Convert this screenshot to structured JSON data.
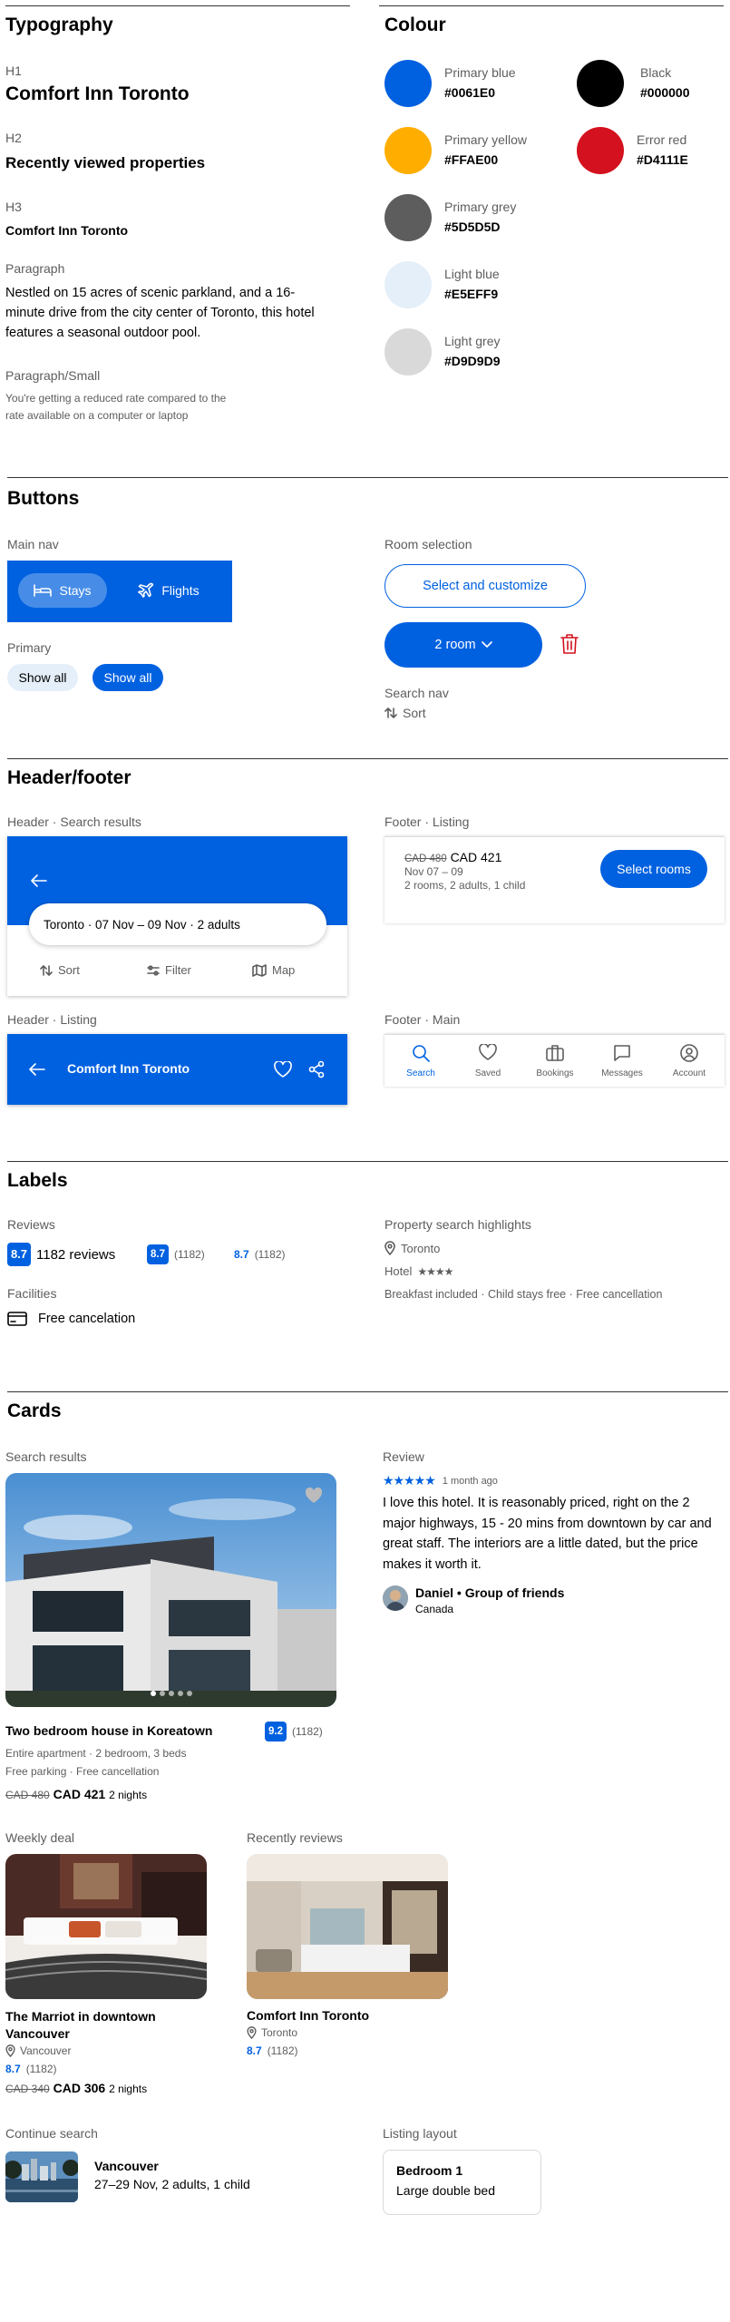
{
  "typography": {
    "title": "Typography",
    "h1_label": "H1",
    "h1_sample": "Comfort Inn Toronto",
    "h2_label": "H2",
    "h2_sample": "Recently viewed properties",
    "h3_label": "H3",
    "h3_sample": "Comfort Inn Toronto",
    "para_label": "Paragraph",
    "para_sample": "Nestled on 15 acres of scenic parkland, and a 16-minute drive from the city center of Toronto, this hotel features a seasonal outdoor pool.",
    "small_label": "Paragraph/Small",
    "small_sample": "You're getting a reduced rate compared to the rate available on a computer or laptop"
  },
  "colour": {
    "title": "Colour",
    "swatches": [
      {
        "name": "Primary blue",
        "hex": "#0061E0"
      },
      {
        "name": "Black",
        "hex": "#000000"
      },
      {
        "name": "Primary yellow",
        "hex": "#FFAE00"
      },
      {
        "name": "Error red",
        "hex": "#D4111E"
      },
      {
        "name": "Primary grey",
        "hex": "#5D5D5D"
      },
      {
        "name": "Light blue",
        "hex": "#E5EFF9"
      },
      {
        "name": "Light grey",
        "hex": "#D9D9D9"
      }
    ]
  },
  "buttons": {
    "title": "Buttons",
    "main_nav_label": "Main nav",
    "stays": "Stays",
    "flights": "Flights",
    "primary_label": "Primary",
    "show_all": "Show all",
    "room_selection_label": "Room selection",
    "select_customize": "Select and customize",
    "room_count": "2 room",
    "search_nav_label": "Search nav",
    "sort": "Sort"
  },
  "header_footer": {
    "title": "Header/footer",
    "search_results_label": "Header · Search results",
    "search_summary": "Toronto · 07 Nov – 09 Nov · 2 adults",
    "sort": "Sort",
    "filter": "Filter",
    "map": "Map",
    "listing_label": "Header · Listing",
    "listing_title": "Comfort Inn Toronto",
    "footer_listing_label": "Footer · Listing",
    "old_price": "CAD 480",
    "new_price": "CAD 421",
    "dates": "Nov 07 – 09",
    "guests": "2 rooms, 2 adults, 1 child",
    "select_rooms": "Select rooms",
    "footer_main_label": "Footer · Main",
    "tabs": [
      "Search",
      "Saved",
      "Bookings",
      "Messages",
      "Account"
    ]
  },
  "labels": {
    "title": "Labels",
    "reviews_label": "Reviews",
    "score": "8.7",
    "reviews_text": "1182 reviews",
    "reviews_count": "(1182)",
    "facilities_label": "Facilities",
    "free_cancel": "Free cancelation",
    "highlights_label": "Property search highlights",
    "location": "Toronto",
    "property_type": "Hotel",
    "amenities": "Breakfast included · Child stays free · Free cancellation"
  },
  "cards": {
    "title": "Cards",
    "search_results_label": "Search results",
    "house_title": "Two bedroom house in Koreatown",
    "house_score": "9.2",
    "house_count": "(1182)",
    "house_desc": "Entire apartment · 2 bedroom, 3 beds",
    "house_extras": "Free parking · Free cancellation",
    "house_old_price": "CAD 480",
    "house_new_price": "CAD 421",
    "house_nights": "2 nights",
    "review_label": "Review",
    "review_time": "1 month ago",
    "review_text": "I love this hotel. It is reasonably priced, right on the 2 major highways, 15 - 20 mins from downtown by car and great staff. The interiors are a little dated, but the price makes it worth it.",
    "reviewer": "Daniel • Group of friends",
    "reviewer_country": "Canada",
    "weekly_label": "Weekly deal",
    "marriot_title": "The Marriot in downtown Vancouver",
    "marriot_location": "Vancouver",
    "marriot_score": "8.7",
    "marriot_count": "(1182)",
    "marriot_old_price": "CAD 340",
    "marriot_new_price": "CAD 306",
    "marriot_nights": "2 nights",
    "recent_label": "Recently reviews",
    "comfort_title": "Comfort Inn Toronto",
    "comfort_location": "Toronto",
    "comfort_score": "8.7",
    "comfort_count": "(1182)",
    "continue_label": "Continue search",
    "continue_city": "Vancouver",
    "continue_details": "27–29 Nov, 2 adults, 1 child",
    "listing_layout_label": "Listing layout",
    "bedroom_title": "Bedroom 1",
    "bedroom_bed": "Large double bed"
  }
}
